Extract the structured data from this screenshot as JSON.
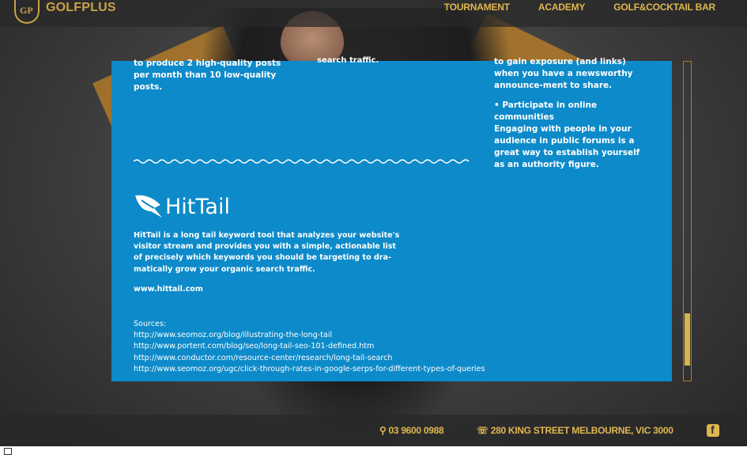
{
  "brand": {
    "name": "GOLFPLUS"
  },
  "nav": [
    "TOURNAMENT",
    "ACADEMY",
    "GOLF&COCKTAIL BAR"
  ],
  "infographic": {
    "col1_text": "to produce 2 high-quality posts per month than 10 low-quality posts.",
    "col2_text": "search traffic.",
    "col3_text": "to gain exposure (and links) when you have a newsworthy announce-ment to share.",
    "col3_heading": "• Participate in online communities",
    "col3_body": "Engaging with people in your audience in public forums is a great way to establish yourself as an authority figure.",
    "tool_name": "HitTail",
    "tool_desc": "HitTail is a long tail keyword tool that analyzes your website's visitor stream and provides you with a simple, actionable list of precisely which keywords you should be targeting to dra-matically grow your organic search traffic.",
    "tool_site": "www.hittail.com",
    "sources_label": "Sources:",
    "sources": [
      "http://www.seomoz.org/blog/illustrating-the-long-tail",
      "http://www.portent.com/blog/seo/long-tail-seo-101-defined.htm",
      "http://www.conductor.com/resource-center/research/long-tail-search",
      "http://www.seomoz.org/ugc/click-through-rates-in-google-serps-for-different-types-of-queries"
    ]
  },
  "footer": {
    "phone": "03 9600 0988",
    "address": "280 KING STREET MELBOURNE, VIC 3000"
  },
  "icons": [
    "logo-icon",
    "phone-icon",
    "phone-glyph",
    "facebook-icon",
    "hittail-leaf-icon"
  ]
}
